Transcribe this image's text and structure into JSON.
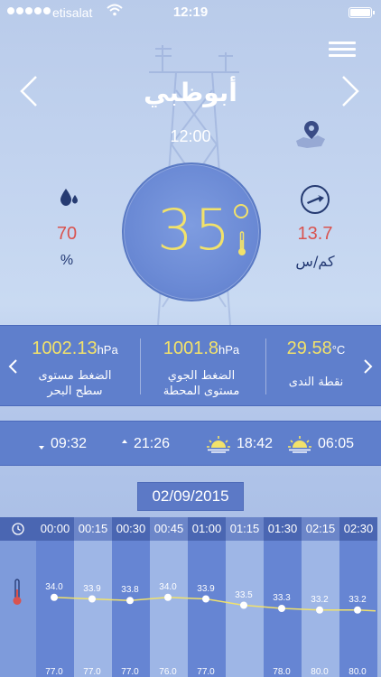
{
  "status": {
    "carrier": "etisalat",
    "time": "12:19"
  },
  "location": {
    "city": "أبوظبي",
    "time": "12:00"
  },
  "current": {
    "temperature": "35",
    "humidity": "70",
    "humidity_unit": "%",
    "wind_speed": "13.7",
    "wind_unit": "كم/س"
  },
  "pressure": [
    {
      "value": "1002.13",
      "unit": "hPa",
      "label_1": "الضغط مستوى",
      "label_2": "سطح البحر"
    },
    {
      "value": "1001.8",
      "unit": "hPa",
      "label_1": "الضغط الجوي",
      "label_2": "مستوى المحطة"
    },
    {
      "value": "29.58",
      "unit": "°C",
      "label_1": "نقطة الندى",
      "label_2": ""
    }
  ],
  "sun_moon": {
    "moonset": "09:32",
    "moonrise": "21:26",
    "sunset": "18:42",
    "sunrise": "06:05"
  },
  "forecast": {
    "date": "02/09/2015",
    "times": [
      "00:00",
      "00:15",
      "00:30",
      "00:45",
      "01:00",
      "01:15",
      "01:30",
      "02:15",
      "02:30"
    ],
    "temperatures": [
      34.0,
      33.9,
      33.8,
      34.0,
      33.9,
      33.5,
      33.3,
      33.2,
      33.2
    ],
    "temperature_labels": [
      "34.0",
      "33.9",
      "33.8",
      "34.0",
      "33.9",
      "33.5",
      "33.3",
      "33.2",
      "33.2"
    ],
    "bottom_labels": [
      "77.0",
      "77.0",
      "77.0",
      "76.0",
      "77.0",
      "",
      "78.0",
      "80.0",
      "80.0"
    ]
  },
  "colors": {
    "accent_yellow": "#f2e26a",
    "value_red": "#d9534f",
    "band_blue": "#5f7fcc"
  },
  "icons": [
    "menu-icon",
    "chevron-left-icon",
    "chevron-right-icon",
    "map-pin-icon",
    "droplet-icon",
    "wind-arrow-icon",
    "thermometer-icon",
    "moonset-icon",
    "moonrise-icon",
    "sunset-icon",
    "sunrise-icon",
    "clock-icon"
  ]
}
